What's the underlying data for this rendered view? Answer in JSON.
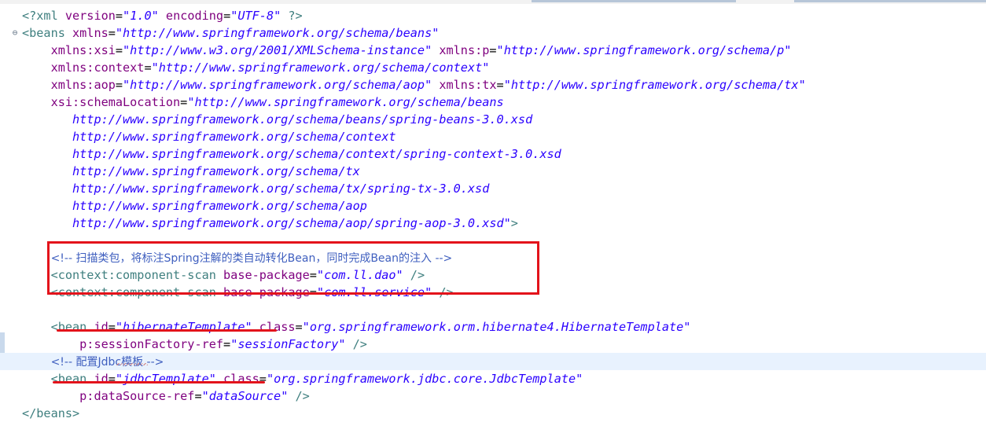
{
  "editor": {
    "lines": [
      {
        "indent": "",
        "parts": [
          {
            "t": "<?xml ",
            "c": "pi"
          },
          {
            "t": "version",
            "c": "attr"
          },
          {
            "t": "=",
            "c": "plain"
          },
          {
            "t": "\"1.0\"",
            "c": "val"
          },
          {
            "t": " ",
            "c": "plain"
          },
          {
            "t": "encoding",
            "c": "attr"
          },
          {
            "t": "=",
            "c": "plain"
          },
          {
            "t": "\"UTF-8\"",
            "c": "val"
          },
          {
            "t": " ?>",
            "c": "pi"
          }
        ]
      },
      {
        "indent": "",
        "fold": "⊖",
        "parts": [
          {
            "t": "<beans ",
            "c": "tag"
          },
          {
            "t": "xmlns",
            "c": "attr"
          },
          {
            "t": "=",
            "c": "plain"
          },
          {
            "t": "\"http://www.springframework.org/schema/beans\"",
            "c": "val"
          }
        ]
      },
      {
        "indent": "    ",
        "parts": [
          {
            "t": "xmlns:xsi",
            "c": "attr"
          },
          {
            "t": "=",
            "c": "plain"
          },
          {
            "t": "\"http://www.w3.org/2001/XMLSchema-instance\"",
            "c": "val"
          },
          {
            "t": " ",
            "c": "plain"
          },
          {
            "t": "xmlns:p",
            "c": "attr"
          },
          {
            "t": "=",
            "c": "plain"
          },
          {
            "t": "\"http://www.springframework.org/schema/p\"",
            "c": "val"
          }
        ]
      },
      {
        "indent": "    ",
        "parts": [
          {
            "t": "xmlns:context",
            "c": "attr"
          },
          {
            "t": "=",
            "c": "plain"
          },
          {
            "t": "\"http://www.springframework.org/schema/context\"",
            "c": "val"
          }
        ]
      },
      {
        "indent": "    ",
        "parts": [
          {
            "t": "xmlns:aop",
            "c": "attr"
          },
          {
            "t": "=",
            "c": "plain"
          },
          {
            "t": "\"http://www.springframework.org/schema/aop\"",
            "c": "val"
          },
          {
            "t": " ",
            "c": "plain"
          },
          {
            "t": "xmlns:tx",
            "c": "attr"
          },
          {
            "t": "=",
            "c": "plain"
          },
          {
            "t": "\"http://www.springframework.org/schema/tx\"",
            "c": "val"
          }
        ]
      },
      {
        "indent": "    ",
        "parts": [
          {
            "t": "xsi:schemaLocation",
            "c": "attr"
          },
          {
            "t": "=",
            "c": "plain"
          },
          {
            "t": "\"http://www.springframework.org/schema/beans",
            "c": "val"
          }
        ]
      },
      {
        "indent": "       ",
        "parts": [
          {
            "t": "http://www.springframework.org/schema/beans/spring-beans-3.0.xsd",
            "c": "val"
          }
        ]
      },
      {
        "indent": "       ",
        "parts": [
          {
            "t": "http://www.springframework.org/schema/context",
            "c": "val"
          }
        ]
      },
      {
        "indent": "       ",
        "parts": [
          {
            "t": "http://www.springframework.org/schema/context/spring-context-3.0.xsd",
            "c": "val"
          }
        ]
      },
      {
        "indent": "       ",
        "parts": [
          {
            "t": "http://www.springframework.org/schema/tx",
            "c": "val"
          }
        ]
      },
      {
        "indent": "       ",
        "parts": [
          {
            "t": "http://www.springframework.org/schema/tx/spring-tx-3.0.xsd",
            "c": "val"
          }
        ]
      },
      {
        "indent": "       ",
        "parts": [
          {
            "t": "http://www.springframework.org/schema/aop",
            "c": "val"
          }
        ]
      },
      {
        "indent": "       ",
        "parts": [
          {
            "t": "http://www.springframework.org/schema/aop/spring-aop-3.0.xsd\"",
            "c": "val"
          },
          {
            "t": ">",
            "c": "tag"
          }
        ]
      },
      {
        "indent": "",
        "parts": []
      },
      {
        "indent": "    ",
        "parts": [
          {
            "t": "<!-- 扫描类包，将标注Spring注解的类自动转化Bean，同时完成Bean的注入 -->",
            "c": "cmt"
          }
        ]
      },
      {
        "indent": "    ",
        "parts": [
          {
            "t": "<context:component-scan ",
            "c": "tag"
          },
          {
            "t": "base-package",
            "c": "attr"
          },
          {
            "t": "=",
            "c": "plain"
          },
          {
            "t": "\"com.ll.dao\"",
            "c": "val"
          },
          {
            "t": " />",
            "c": "tag"
          }
        ]
      },
      {
        "indent": "    ",
        "parts": [
          {
            "t": "<context:component-scan ",
            "c": "tag"
          },
          {
            "t": "base-package",
            "c": "attr"
          },
          {
            "t": "=",
            "c": "plain"
          },
          {
            "t": "\"com.ll.service\"",
            "c": "val"
          },
          {
            "t": " />",
            "c": "tag"
          }
        ]
      },
      {
        "indent": "",
        "parts": []
      },
      {
        "indent": "    ",
        "parts": [
          {
            "t": "<bean ",
            "c": "tag"
          },
          {
            "t": "id",
            "c": "attr"
          },
          {
            "t": "=",
            "c": "plain"
          },
          {
            "t": "\"hibernateTemplate\"",
            "c": "val"
          },
          {
            "t": " ",
            "c": "plain"
          },
          {
            "t": "class",
            "c": "attr"
          },
          {
            "t": "=",
            "c": "plain"
          },
          {
            "t": "\"org.springframework.orm.hibernate4.HibernateTemplate\"",
            "c": "val"
          }
        ]
      },
      {
        "indent": "        ",
        "parts": [
          {
            "t": "p:sessionFactory-ref",
            "c": "attr"
          },
          {
            "t": "=",
            "c": "plain"
          },
          {
            "t": "\"sessionFactory\"",
            "c": "val"
          },
          {
            "t": " />",
            "c": "tag"
          }
        ]
      },
      {
        "indent": "    ",
        "hl": true,
        "parts": [
          {
            "t": "<!-- 配置Jdbc模板 -->",
            "c": "cmt"
          }
        ]
      },
      {
        "indent": "    ",
        "parts": [
          {
            "t": "<bean ",
            "c": "tag"
          },
          {
            "t": "id",
            "c": "attr"
          },
          {
            "t": "=",
            "c": "plain"
          },
          {
            "t": "\"jdbcTemplate\"",
            "c": "val"
          },
          {
            "t": " ",
            "c": "plain"
          },
          {
            "t": "class",
            "c": "attr"
          },
          {
            "t": "=",
            "c": "plain"
          },
          {
            "t": "\"org.springframework.jdbc.core.JdbcTemplate\"",
            "c": "val"
          }
        ]
      },
      {
        "indent": "        ",
        "parts": [
          {
            "t": "p:dataSource-ref",
            "c": "attr"
          },
          {
            "t": "=",
            "c": "plain"
          },
          {
            "t": "\"dataSource\"",
            "c": "val"
          },
          {
            "t": " />",
            "c": "tag"
          }
        ]
      },
      {
        "indent": "",
        "parts": [
          {
            "t": "</beans>",
            "c": "tag"
          }
        ]
      }
    ]
  },
  "colors": {
    "tag": "#3f7f7f",
    "attr": "#7f007f",
    "value": "#2a00ff",
    "comment": "#3f5fbf",
    "annotation_red": "#e3131b",
    "current_line": "#e8f2fe"
  }
}
